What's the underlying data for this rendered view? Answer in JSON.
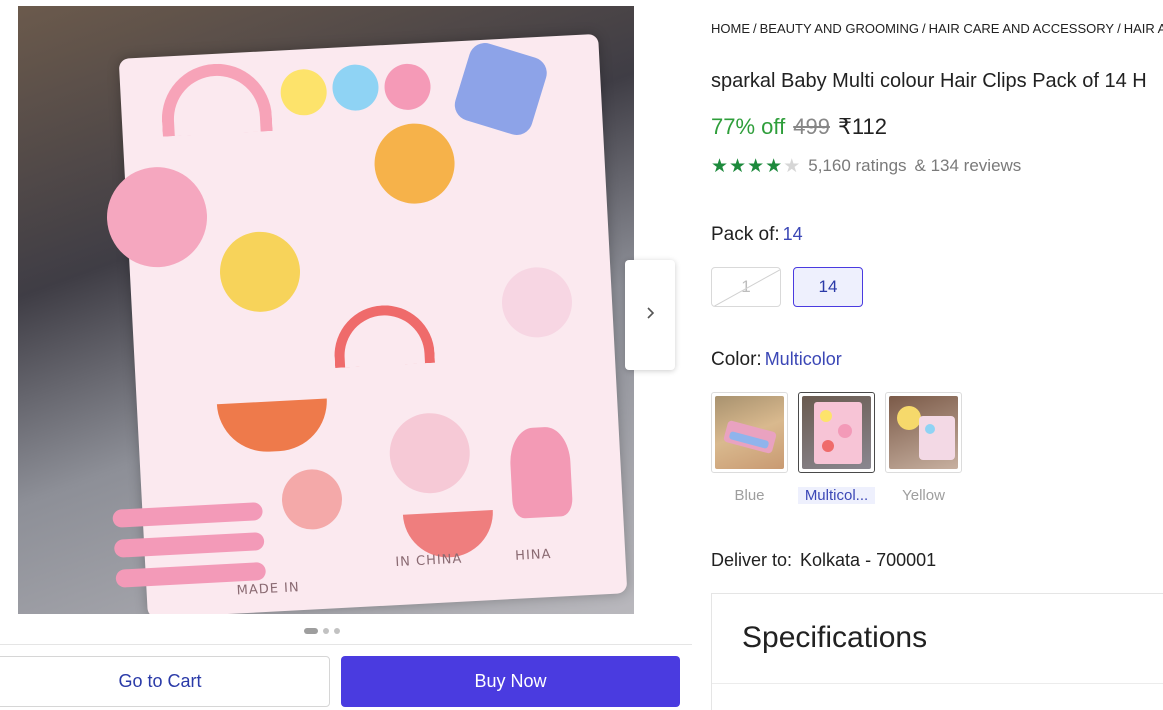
{
  "gallery": {
    "image_captions": [
      "MADE IN",
      "IN CHINA",
      "HINA"
    ],
    "next_icon": "chevron-right-icon",
    "dots": [
      true,
      false,
      false
    ]
  },
  "actions": {
    "go_to_cart": "Go to Cart",
    "buy_now": "Buy Now"
  },
  "breadcrumb": [
    "HOME",
    "BEAUTY AND GROOMING",
    "HAIR CARE AND ACCESSORY",
    "HAIR ACC"
  ],
  "product": {
    "title": "sparkal Baby Multi colour Hair Clips Pack of 14 H",
    "discount": "77% off",
    "mrp": "499",
    "price": "₹112",
    "rating_stars": 4,
    "ratings_count": "5,160 ratings",
    "reviews_count": "& 134 reviews"
  },
  "pack": {
    "label": "Pack of:",
    "selected": "14",
    "options": [
      "1",
      "14"
    ]
  },
  "color": {
    "label": "Color:",
    "selected": "Multicolor",
    "options": [
      "Blue",
      "Multicol...",
      "Yellow"
    ]
  },
  "delivery": {
    "label": "Deliver to:",
    "location": "Kolkata - 700001"
  },
  "specifications": {
    "title": "Specifications"
  },
  "colors": {
    "accent": "#4a3be0",
    "link": "#3b47b6",
    "discount_green": "#2e9e3a",
    "star_green": "#1d8a3c"
  }
}
